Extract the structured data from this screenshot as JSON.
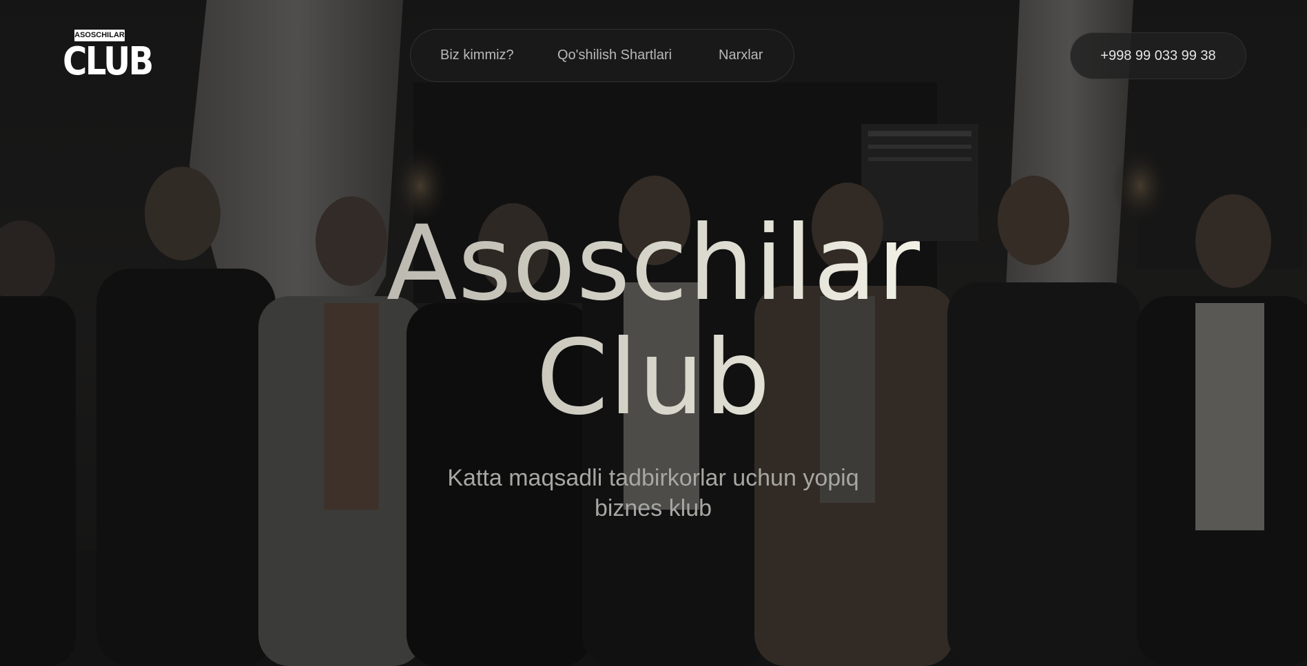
{
  "logo": {
    "top_text": "ASOSCHILAR",
    "main_text": "CLUB"
  },
  "nav": {
    "items": [
      {
        "label": "Biz kimmiz?"
      },
      {
        "label": "Qo'shilish Shartlari"
      },
      {
        "label": "Narxlar"
      }
    ]
  },
  "contact": {
    "phone": "+998 99 033 99 38"
  },
  "hero": {
    "title_line1": "Asoschilar",
    "title_line2": "Club",
    "subtitle": "Katta maqsadli tadbirkorlar uchun yopiq biznes klub",
    "background": "group photo of nine men in dark suits standing in a dim restaurant with curtains"
  },
  "colors": {
    "page_bg": "#141414",
    "nav_text": "#b9b9b9",
    "phone_text": "#e6e6e6",
    "title_gradient_start": "#9a9891",
    "title_gradient_end": "#fbfaf0",
    "subtitle_text": "#a7a7a3"
  }
}
